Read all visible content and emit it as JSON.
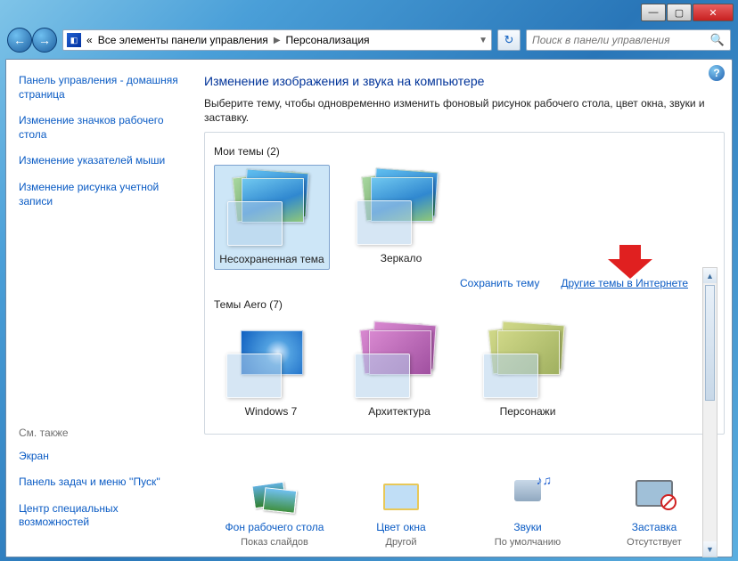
{
  "titlebar": {
    "min": "—",
    "max": "▢",
    "close": "✕"
  },
  "toolbar": {
    "back": "←",
    "fwd": "→",
    "breadcrumb_prefix": "«",
    "breadcrumb1": "Все элементы панели управления",
    "breadcrumb2": "Персонализация",
    "refresh": "↻",
    "search_placeholder": "Поиск в панели управления"
  },
  "help": "?",
  "sidebar": {
    "home": "Панель управления - домашняя страница",
    "icons": "Изменение значков рабочего стола",
    "pointers": "Изменение указателей мыши",
    "account_pic": "Изменение рисунка учетной записи",
    "see_also": "См. также",
    "screen": "Экран",
    "taskbar": "Панель задач и меню ''Пуск''",
    "ease": "Центр специальных возможностей"
  },
  "main": {
    "title": "Изменение изображения и звука на компьютере",
    "desc": "Выберите тему, чтобы одновременно изменить фоновый рисунок рабочего стола, цвет окна, звуки и заставку.",
    "group_my": "Мои темы (2)",
    "group_aero": "Темы Aero (7)",
    "link_save": "Сохранить тему",
    "link_more": "Другие темы в Интернете"
  },
  "themes": {
    "t1": "Несохраненная тема",
    "t2": "Зеркало",
    "a1": "Windows 7",
    "a2": "Архитектура",
    "a3": "Персонажи"
  },
  "bottom": {
    "bg": {
      "title": "Фон рабочего стола",
      "sub": "Показ слайдов"
    },
    "color": {
      "title": "Цвет окна",
      "sub": "Другой"
    },
    "sound": {
      "title": "Звуки",
      "sub": "По умолчанию"
    },
    "saver": {
      "title": "Заставка",
      "sub": "Отсутствует"
    }
  }
}
